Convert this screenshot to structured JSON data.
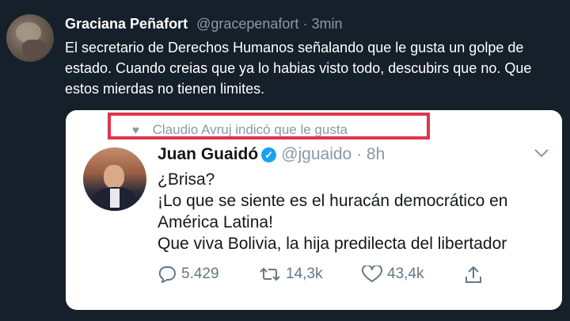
{
  "tweet": {
    "author_name": "Graciana Peñafort",
    "handle": "@gracepenafort",
    "separator": "·",
    "time": "3min",
    "text": "El secretario de Derechos Humanos señalando que le gusta un golpe de estado. Cuando creias que ya lo habias visto todo, descubirs que no. Que estos mierdas no tienen limites."
  },
  "quoted": {
    "liked_notice": "Claudio Avruj indicó que le gusta",
    "author_name": "Juan Guaidó",
    "verified_mark": "✓",
    "handle": "@jguaido",
    "separator": "·",
    "time": "8h",
    "lines": [
      "¿Brisa?",
      "¡Lo que se siente es el huracán democrático en América Latina!",
      "Que viva Bolivia, la hija predilecta del libertador"
    ],
    "replies": "5.429",
    "retweets": "14,3k",
    "likes": "43,4k"
  },
  "icons": {
    "more": "chevron-down-icon",
    "reply": "reply-icon",
    "retweet": "retweet-icon",
    "like": "heart-icon",
    "share": "share-icon"
  },
  "colors": {
    "background": "#15202b",
    "card": "#ffffff",
    "highlight_border": "#e0334d",
    "verified": "#1da1f2",
    "muted": "#8899a6"
  }
}
